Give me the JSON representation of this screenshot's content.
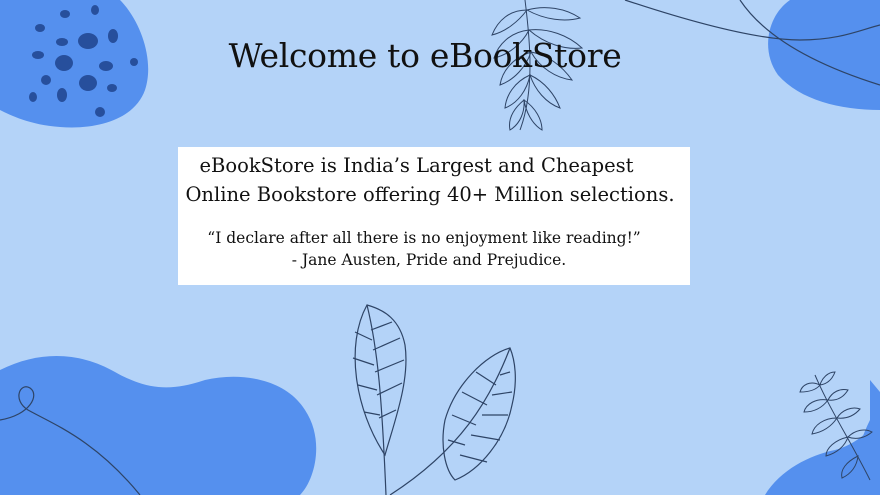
{
  "page": {
    "title": "Welcome to eBookStore",
    "intro": {
      "line1": "eBookStore is India’s Largest and Cheapest",
      "line2": "Online Bookstore offering 40+ Million selections."
    },
    "quote": {
      "text": "“I  declare after all there is no enjoyment like reading!”",
      "attribution": "- Jane Austen, Pride and Prejudice."
    }
  },
  "colors": {
    "background": "#b4d3f8",
    "blob": "#5590ee",
    "dots": "#274f9c",
    "line_art": "#2e4466",
    "card": "#ffffff"
  },
  "decorations": [
    "blob-dots-top-left",
    "fern-sprig-top",
    "blob-top-right",
    "blob-bottom-left",
    "leaves-bottom-center",
    "fern-bottom-right"
  ]
}
